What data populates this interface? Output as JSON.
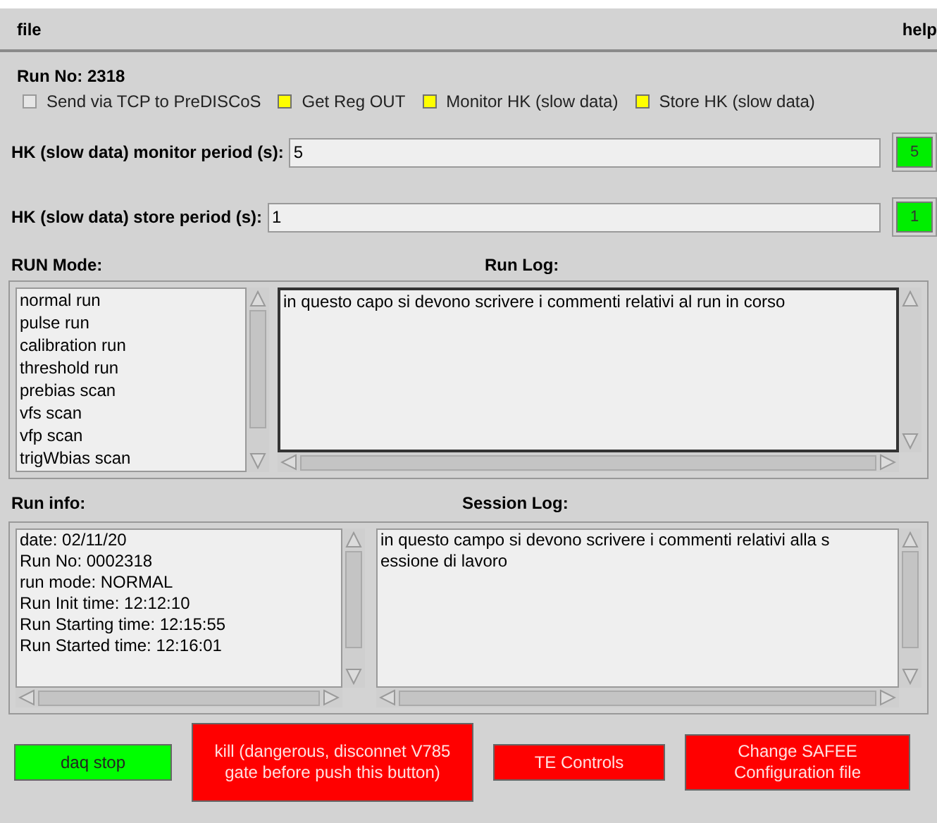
{
  "menu": [
    "file",
    "help"
  ],
  "run_no": "Run No: 2318",
  "options": [
    {
      "label": "Send via TCP to PreDISCoS",
      "checked": false
    },
    {
      "label": "Get Reg OUT",
      "checked": true
    },
    {
      "label": "Monitor HK (slow data)",
      "checked": true
    },
    {
      "label": "Store HK (slow data)",
      "checked": true
    }
  ],
  "periods": [
    {
      "label": "HK (slow data) monitor period (s):",
      "value": "5",
      "button": "5"
    },
    {
      "label": "HK (slow data) store period (s):",
      "value": "1",
      "button": "1"
    }
  ],
  "run_mode": {
    "title": "RUN Mode:",
    "items": [
      "normal run",
      "pulse run",
      "calibration run",
      "threshold run",
      "prebias scan",
      "vfs scan",
      "vfp scan",
      "trigWbias scan"
    ]
  },
  "run_log": {
    "title": "Run Log:",
    "value": "in questo capo si devono scrivere i commenti relativi al run in corso"
  },
  "run_info": {
    "title": "Run info:",
    "lines": [
      "date: 02/11/20",
      "Run No: 0002318",
      "run mode: NORMAL",
      "Run Init time: 12:12:10",
      "Run Starting time: 12:15:55",
      "Run Started time: 12:16:01"
    ]
  },
  "session_log": {
    "title": "Session Log:",
    "lines": [
      "in questo campo si devono scrivere i commenti relativi alla s",
      "essione di lavoro"
    ]
  },
  "buttons": [
    {
      "label": "daq stop",
      "color": "#00ff00"
    },
    {
      "label": "kill (dangerous, disconnet V785 gate before push this button)",
      "color": "#ff0000"
    },
    {
      "label": "TE Controls",
      "color": "#ff0000"
    },
    {
      "label": "Change SAFEE Configuration file",
      "color": "#ff0000"
    }
  ]
}
